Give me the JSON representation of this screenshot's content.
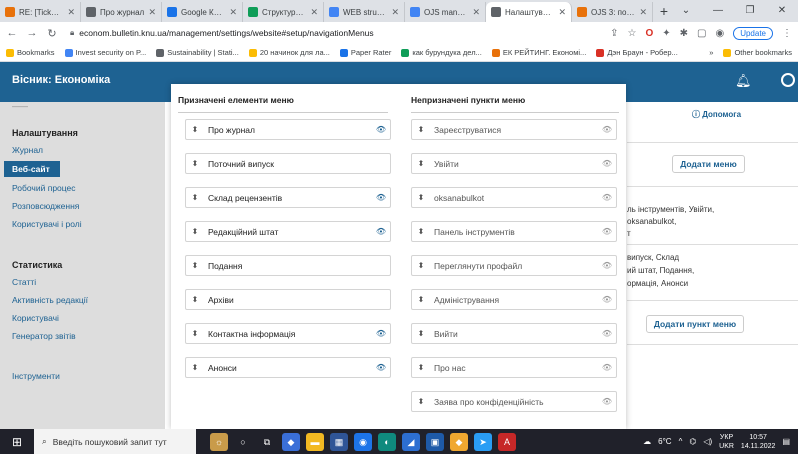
{
  "browser": {
    "tabs": [
      {
        "title": "RE: [Ticket#3...",
        "color": "#e8710a"
      },
      {
        "title": "Про журнал",
        "color": "#5f6368"
      },
      {
        "title": "Google Кален...",
        "color": "#1a73e8"
      },
      {
        "title": "Структура О...",
        "color": "#0f9d58"
      },
      {
        "title": "WEB structu...",
        "color": "#4285f4"
      },
      {
        "title": "OJS manual...",
        "color": "#4285f4"
      },
      {
        "title": "Налаштуванн...",
        "color": "#5f6368",
        "active": true
      },
      {
        "title": "OJS 3: повна...",
        "color": "#e8710a"
      }
    ],
    "new_tab": "+",
    "url": "econom.bulletin.knu.ua/management/settings/website#setup/navigationMenus",
    "update_label": "Update",
    "bookmarks": [
      {
        "label": "Bookmarks",
        "color": "#fbbc04"
      },
      {
        "label": "Invest security on P...",
        "color": "#4285f4"
      },
      {
        "label": "Sustainability | Stati...",
        "color": "#5f6368"
      },
      {
        "label": "20 начинок для ла...",
        "color": "#fbbc04"
      },
      {
        "label": "Paper Rater",
        "color": "#1a73e8"
      },
      {
        "label": "как бурундука дел...",
        "color": "#0f9d58"
      },
      {
        "label": "ЕК РЕЙТИНГ. Економі...",
        "color": "#e8710a"
      },
      {
        "label": "Дэн Браун - Робер...",
        "color": "#d93025"
      }
    ],
    "bookmarks_more": "»",
    "other_bookmarks": "Other bookmarks"
  },
  "app": {
    "brand": "Вісник: Економіка",
    "sidebar": {
      "settings_heading": "Налаштування",
      "items": [
        "Журнал",
        "Веб-сайт",
        "Робочий процес",
        "Розповсюдження",
        "Користувачі і ролі"
      ],
      "stats_heading": "Статистика",
      "stats_items": [
        "Статті",
        "Активність редакції",
        "Користувачі",
        "Генератор звітів"
      ],
      "tools": "Інструменти"
    },
    "help": "Допомога",
    "add_menu": "Додати меню",
    "bg_lines": [
      "ль інструментів, Увійти,",
      "oksanabulkot,",
      "т",
      "випуск, Склад",
      "ий штат, Подання,",
      "ормація, Анонси"
    ],
    "add_item": "Додати пункт меню"
  },
  "dialog": {
    "assigned_title": "Призначені елементи меню",
    "unassigned_title": "Непризначені пункти меню",
    "assigned": [
      {
        "label": "Про журнал",
        "eye": true
      },
      {
        "label": "Поточний випуск",
        "eye": false
      },
      {
        "label": "Склад рецензентів",
        "eye": true
      },
      {
        "label": "Редакційний штат",
        "eye": true
      },
      {
        "label": "Подання",
        "eye": false
      },
      {
        "label": "Архіви",
        "eye": false
      },
      {
        "label": "Контактна інформація",
        "eye": true
      },
      {
        "label": "Анонси",
        "eye": true
      }
    ],
    "unassigned": [
      "Зареєструватися",
      "Увійти",
      "oksanabulkot",
      "Панель інструментів",
      "Переглянути профайл",
      "Адміністрування",
      "Вийти",
      "Про нас",
      "Заява про конфіденційність"
    ]
  },
  "taskbar": {
    "search_placeholder": "Введіть пошуковий запит тут",
    "weather": "6°C",
    "lang": "УКР",
    "lang2": "UKR",
    "time": "10:57",
    "date": "14.11.2022"
  }
}
